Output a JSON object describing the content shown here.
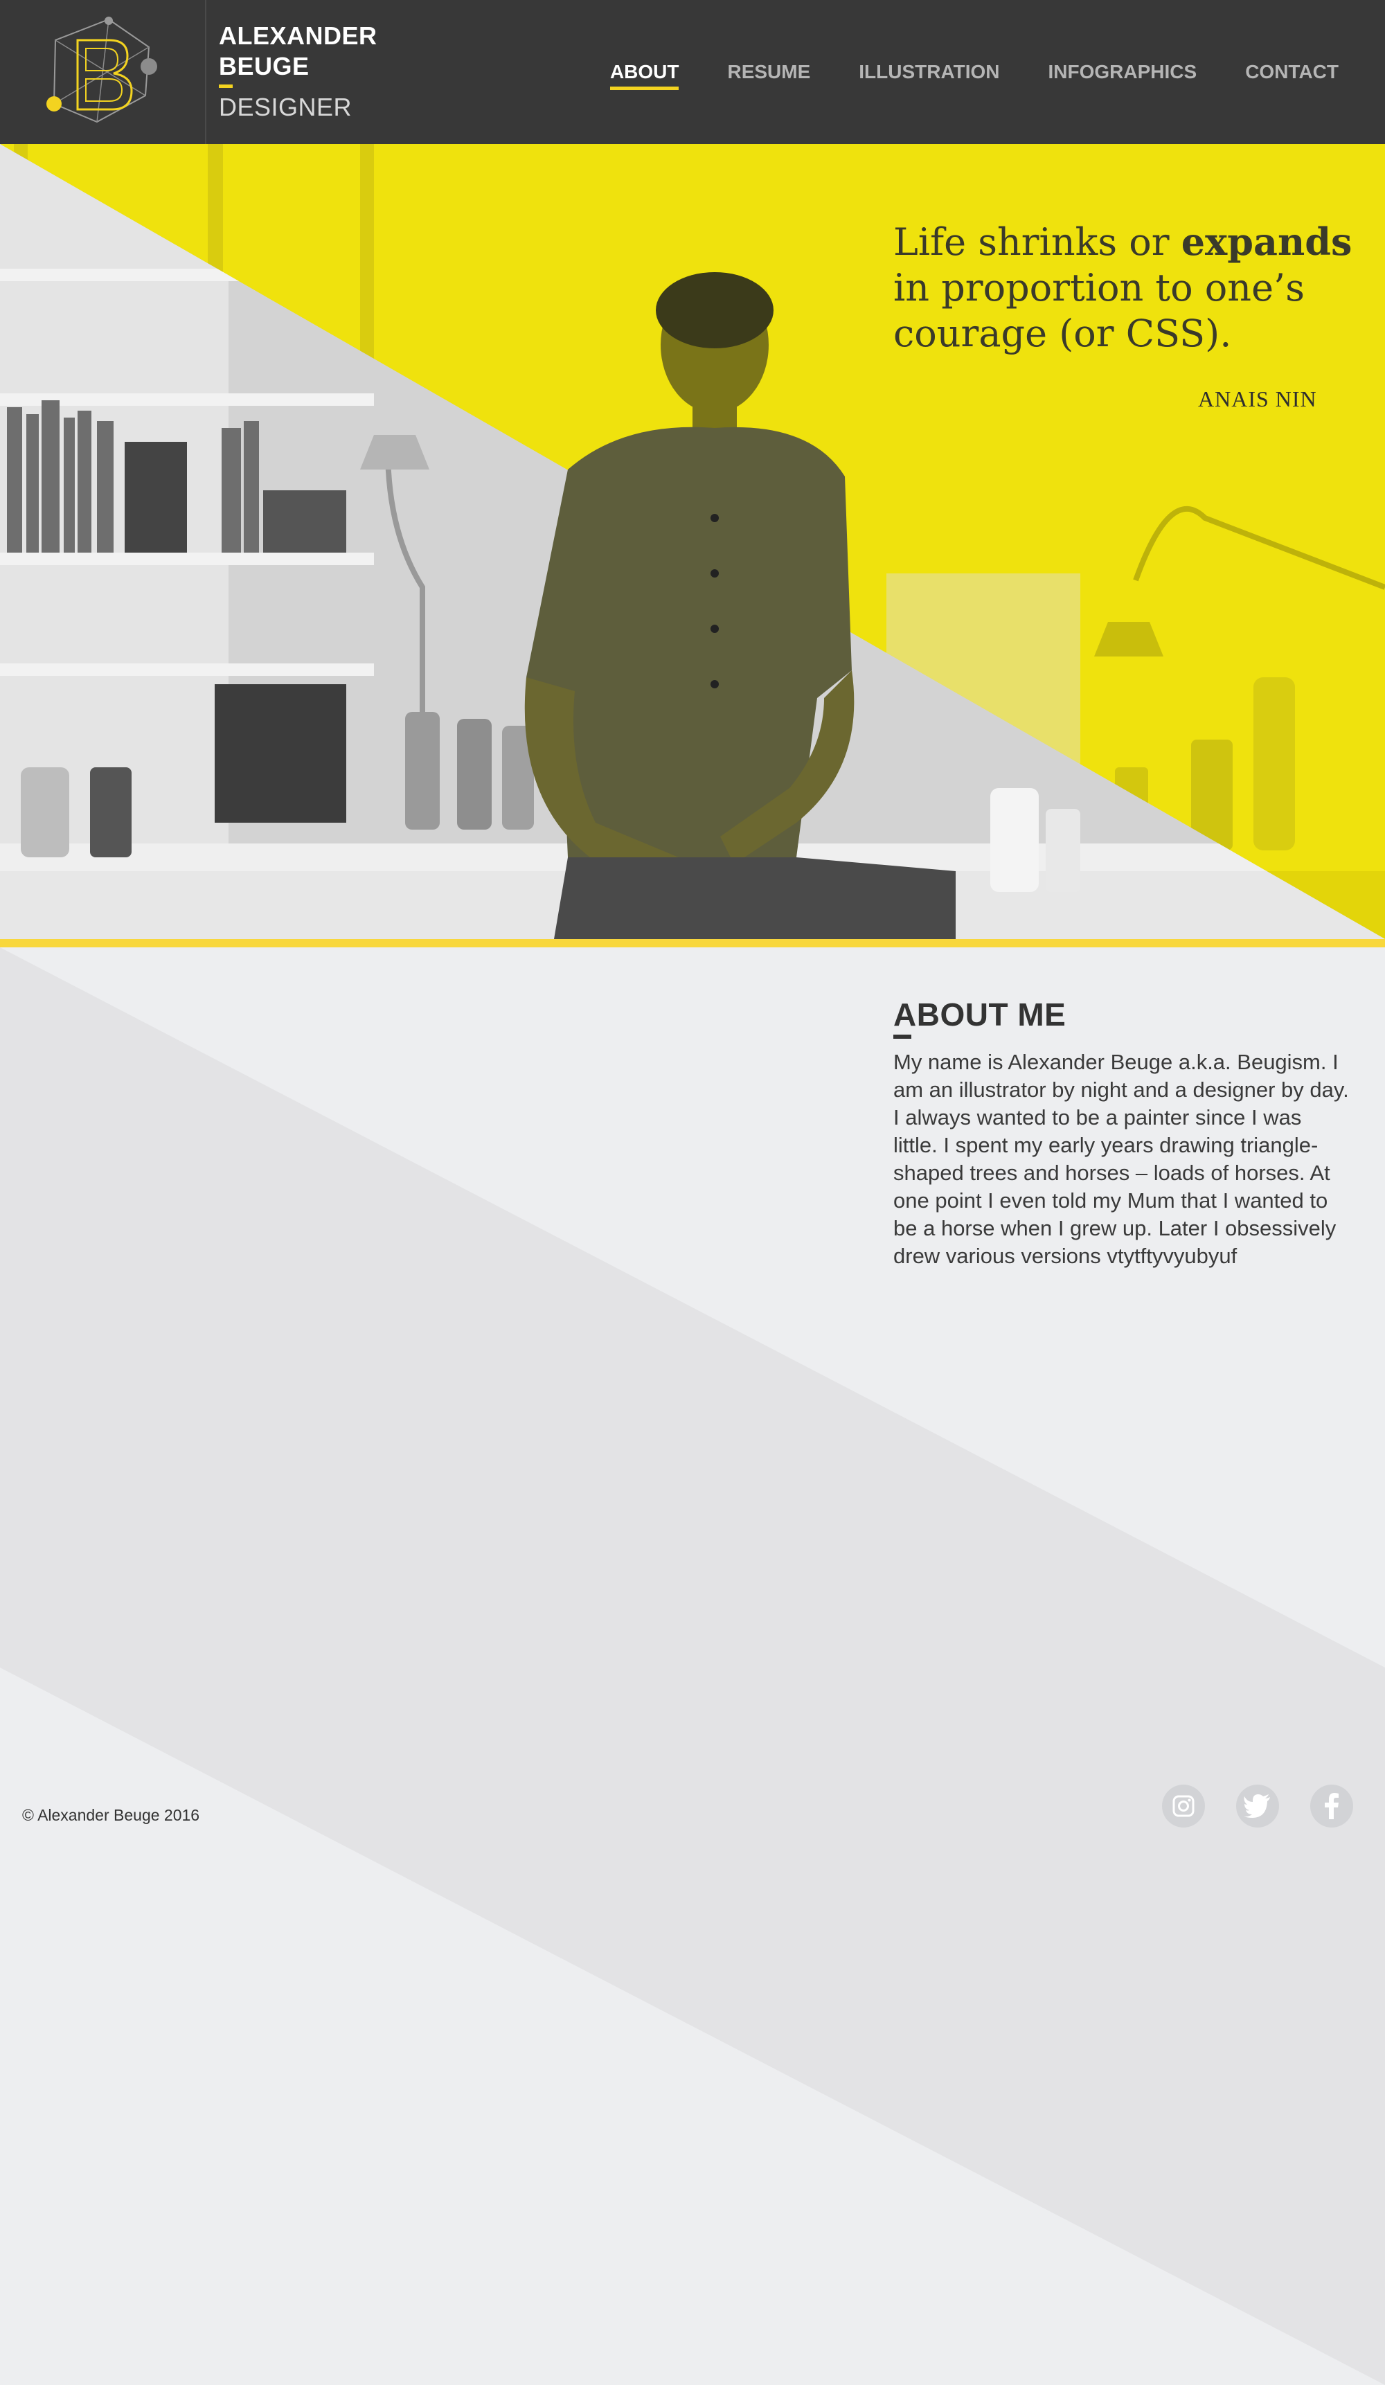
{
  "brand": {
    "first_name": "ALEXANDER",
    "last_name": "BEUGE",
    "role": "DESIGNER",
    "logo_icon": "geometric-b-logo-icon"
  },
  "nav": {
    "items": [
      {
        "label": "ABOUT",
        "active": true
      },
      {
        "label": "RESUME",
        "active": false
      },
      {
        "label": "ILLUSTRATION",
        "active": false
      },
      {
        "label": "INFOGRAPHICS",
        "active": false
      },
      {
        "label": "CONTACT",
        "active": false
      }
    ]
  },
  "hero": {
    "quote_part1": "Life shrinks or ",
    "quote_bold": "expands",
    "quote_part2": " in proportion to one’s courage (or CSS).",
    "author": "ANAIS NIN"
  },
  "about": {
    "title": "ABOUT ME",
    "body": "My name is Alexander Beuge a.k.a. Beugism. I am an illustrator by night and a designer by day. I always wanted to be a painter since I was little. I spent my early years drawing triangle-shaped trees and horses – loads of horses. At one point I even told my Mum that I wanted to be a horse when I grew up. Later I obsessively drew various versions vtytftyvyubyuf"
  },
  "footer": {
    "copyright": "© Alexander Beuge 2016",
    "social": [
      "instagram-icon",
      "twitter-icon",
      "facebook-icon"
    ]
  },
  "colors": {
    "accent": "#f3d320",
    "header_bg": "#383838",
    "page_bg": "#edeef0",
    "band": "#e3e3e5"
  }
}
